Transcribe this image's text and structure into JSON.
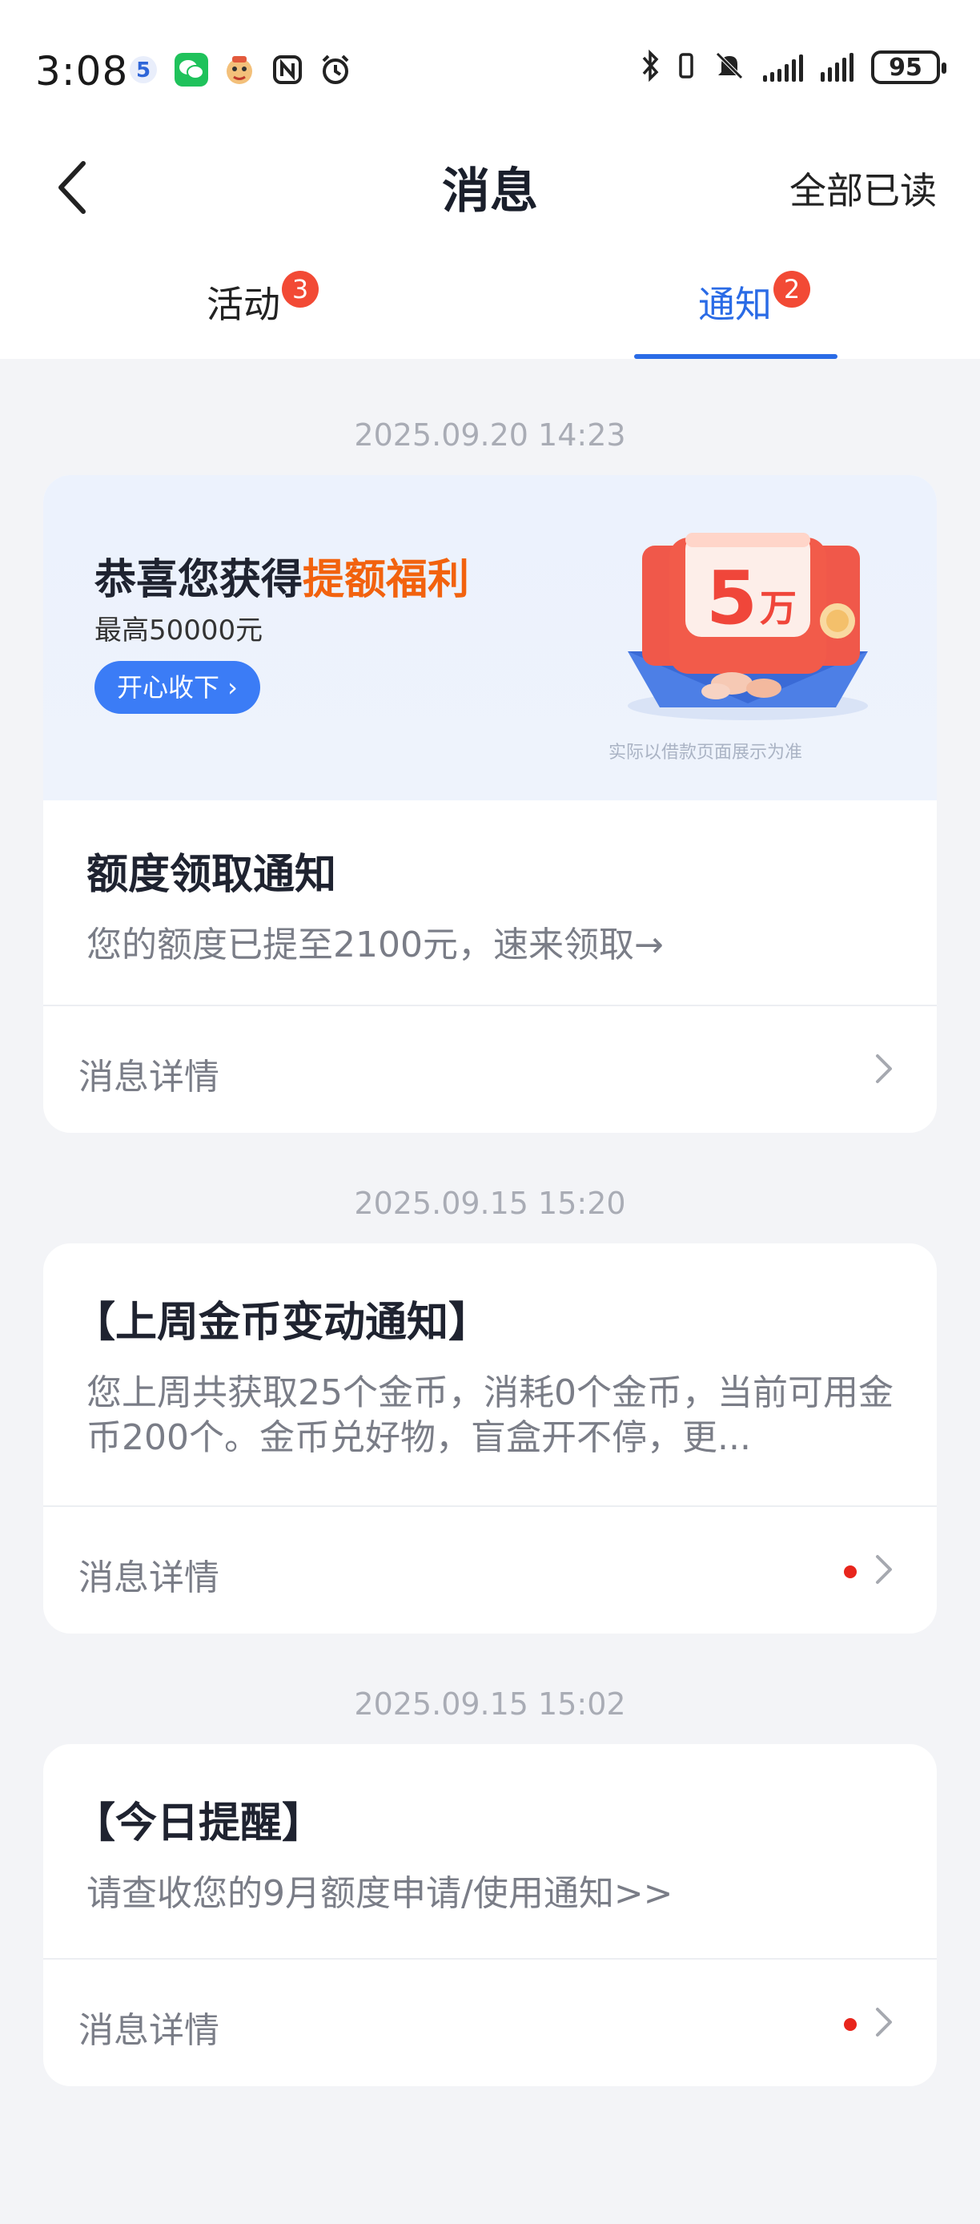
{
  "status_bar": {
    "time": "3:08",
    "battery": "95",
    "icons": [
      "app-badge-icon",
      "wechat-icon",
      "mascot-app-icon",
      "nfc-icon",
      "alarm-icon",
      "bluetooth-icon",
      "vibrate-icon",
      "mute-icon",
      "signal-icon",
      "signal-icon"
    ]
  },
  "header": {
    "title": "消息",
    "read_all": "全部已读"
  },
  "tabs": [
    {
      "label": "活动",
      "badge": "3",
      "active": false
    },
    {
      "label": "通知",
      "badge": "2",
      "active": true
    }
  ],
  "messages": [
    {
      "timestamp": "2025.09.20 14:23",
      "banner": {
        "title_prefix": "恭喜您获得",
        "title_highlight": "提额福利",
        "subtitle": "最高50000元",
        "button": "开心收下 ›",
        "gift_label_num": "5",
        "gift_label_unit": "万",
        "note": "实际以借款页面展示为准"
      },
      "title": "额度领取通知",
      "desc": "您的额度已提至2100元，速来领取→",
      "detail": "消息详情",
      "unread": false
    },
    {
      "timestamp": "2025.09.15 15:20",
      "title": "【上周金币变动通知】",
      "desc": "您上周共获取25个金币，消耗0个金币，当前可用金币200个。金币兑好物，盲盒开不停，更...",
      "detail": "消息详情",
      "unread": true
    },
    {
      "timestamp": "2025.09.15 15:02",
      "title": "【今日提醒】",
      "desc": "请查收您的9月额度申请/使用通知>>",
      "detail": "消息详情",
      "unread": true
    }
  ],
  "colors": {
    "accent": "#2a6be6",
    "badge": "#f24a35",
    "highlight": "#f2620e",
    "unread_dot": "#e8251c"
  }
}
